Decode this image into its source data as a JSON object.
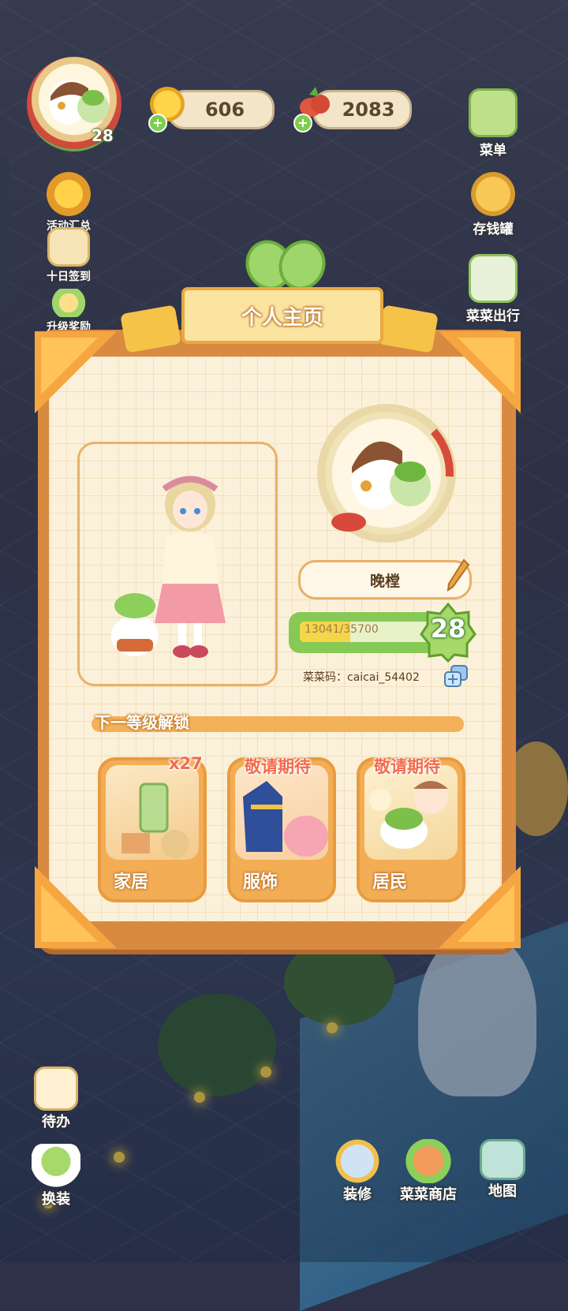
{
  "hud": {
    "avatar_level": "28",
    "coins": "606",
    "veggies": "2083"
  },
  "left_menu": [
    {
      "label": "活动汇总",
      "icon": "event-summary-icon"
    },
    {
      "label": "十日签到",
      "icon": "ten-day-signin-icon"
    },
    {
      "label": "升级奖励",
      "icon": "level-reward-icon"
    }
  ],
  "right_menu": [
    {
      "label": "菜单",
      "icon": "menu-icon"
    },
    {
      "label": "存钱罐",
      "icon": "piggy-bank-icon"
    },
    {
      "label": "菜菜出行",
      "icon": "travel-icon"
    }
  ],
  "modal": {
    "title": "个人主页",
    "player_name": "晚樘",
    "xp_current": 13041,
    "xp_max": 35700,
    "xp_text": "13041/35700",
    "level": "28",
    "code_text": "菜菜码：caicai_54402",
    "next_unlock_title": "下一等级解锁",
    "unlock_items": [
      {
        "label": "家居",
        "badge": "x27"
      },
      {
        "label": "服饰",
        "badge": "敬请期待"
      },
      {
        "label": "居民",
        "badge": "敬请期待"
      }
    ]
  },
  "bottom_left": [
    {
      "label": "待办",
      "icon": "todo-icon"
    },
    {
      "label": "换装",
      "icon": "dress-up-icon"
    }
  ],
  "bottom_right": [
    {
      "label": "装修",
      "icon": "decorate-icon"
    },
    {
      "label": "菜菜商店",
      "icon": "shop-icon"
    },
    {
      "label": "地图",
      "icon": "map-icon"
    }
  ],
  "colors": {
    "panel_orange": "#d88a41",
    "paper": "#fbf1da",
    "xp_fill": "#f5d64a",
    "level_green": "#86c954"
  }
}
